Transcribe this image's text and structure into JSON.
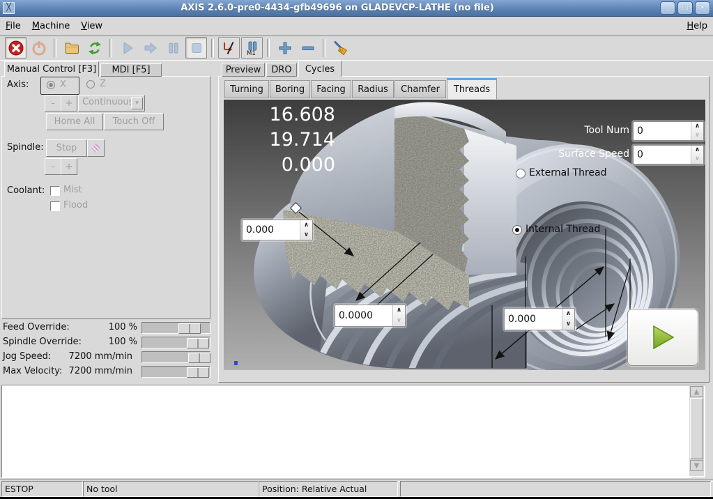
{
  "window": {
    "title": "AXIS 2.6.0-pre0-4434-gfb49696 on GLADEVCP-LATHE (no file)",
    "controls": {
      "minimize": "_",
      "maximize": "□",
      "close": "×"
    }
  },
  "menubar": {
    "items": [
      {
        "label": "File"
      },
      {
        "label": "Machine"
      },
      {
        "label": "View"
      }
    ],
    "help": {
      "label": "Help"
    }
  },
  "toolbar": {
    "icons": {
      "estop": "emergency-stop ⊗",
      "machine_power": "power ⏻",
      "open": "open-file 📁",
      "reload": "reload ↻",
      "run": "run ▶",
      "step": "step ➡",
      "pause": "pause ⏸",
      "stop": "stop ■",
      "block_delete": "block-delete /",
      "optional_pause": "optional-pause M1",
      "zoom_in": "zoom-in +",
      "zoom_out": "zoom-out −",
      "clear_plot": "clear-plot broom"
    },
    "optional_pause_text": "M1"
  },
  "glyphs": {
    "combo_arrow": "▾",
    "spin_up": "∧",
    "spin_down": "∨",
    "scroll_up": "▲",
    "scroll_down": "▼"
  },
  "left_panel": {
    "tabs": [
      {
        "label": "Manual Control [F3]",
        "selected": true
      },
      {
        "label": "MDI [F5]",
        "selected": false
      }
    ],
    "axis": {
      "label": "Axis:",
      "options": [
        {
          "label": "X",
          "selected": true
        },
        {
          "label": "Z",
          "selected": false
        }
      ]
    },
    "jog": {
      "minus_label": "-",
      "plus_label": "+",
      "increment_value": "Continuous",
      "home_all_label": "Home All",
      "touch_off_label": "Touch Off"
    },
    "spindle": {
      "label": "Spindle:",
      "stop_label": "Stop",
      "minus_label": "-",
      "plus_label": "+"
    },
    "coolant": {
      "label": "Coolant:",
      "mist_label": "Mist",
      "flood_label": "Flood"
    },
    "overrides": [
      {
        "label": "Feed Override:",
        "value": "100 %"
      },
      {
        "label": "Spindle Override:",
        "value": "100 %"
      },
      {
        "label": "Jog Speed:",
        "value": "7200 mm/min"
      },
      {
        "label": "Max Velocity:",
        "value": "7200 mm/min"
      }
    ]
  },
  "right_panel": {
    "tabs": [
      {
        "label": "Preview",
        "selected": false
      },
      {
        "label": "DRO",
        "selected": false
      },
      {
        "label": "Cycles",
        "selected": true
      }
    ],
    "cycle_tabs": [
      {
        "label": "Turning",
        "selected": false
      },
      {
        "label": "Boring",
        "selected": false
      },
      {
        "label": "Facing",
        "selected": false
      },
      {
        "label": "Radius",
        "selected": false
      },
      {
        "label": "Chamfer",
        "selected": false
      },
      {
        "label": "Threads",
        "selected": true
      }
    ],
    "threads": {
      "dro": [
        "16.608",
        "19.714",
        "0.000"
      ],
      "tool_num": {
        "label": "Tool Num",
        "value": "0"
      },
      "surface_speed": {
        "label": "Surface Speed",
        "value": "0"
      },
      "thread_type": [
        {
          "label": "External Thread",
          "selected": false
        },
        {
          "label": "Internal Thread",
          "selected": true
        }
      ],
      "inputs": {
        "left_value": "0.000",
        "pitch_value": "0.0000",
        "length_value": "0.000"
      }
    }
  },
  "message_area": {
    "content": ""
  },
  "statusbar": {
    "cells": [
      "ESTOP",
      "No tool",
      "Position: Relative Actual",
      ""
    ]
  }
}
